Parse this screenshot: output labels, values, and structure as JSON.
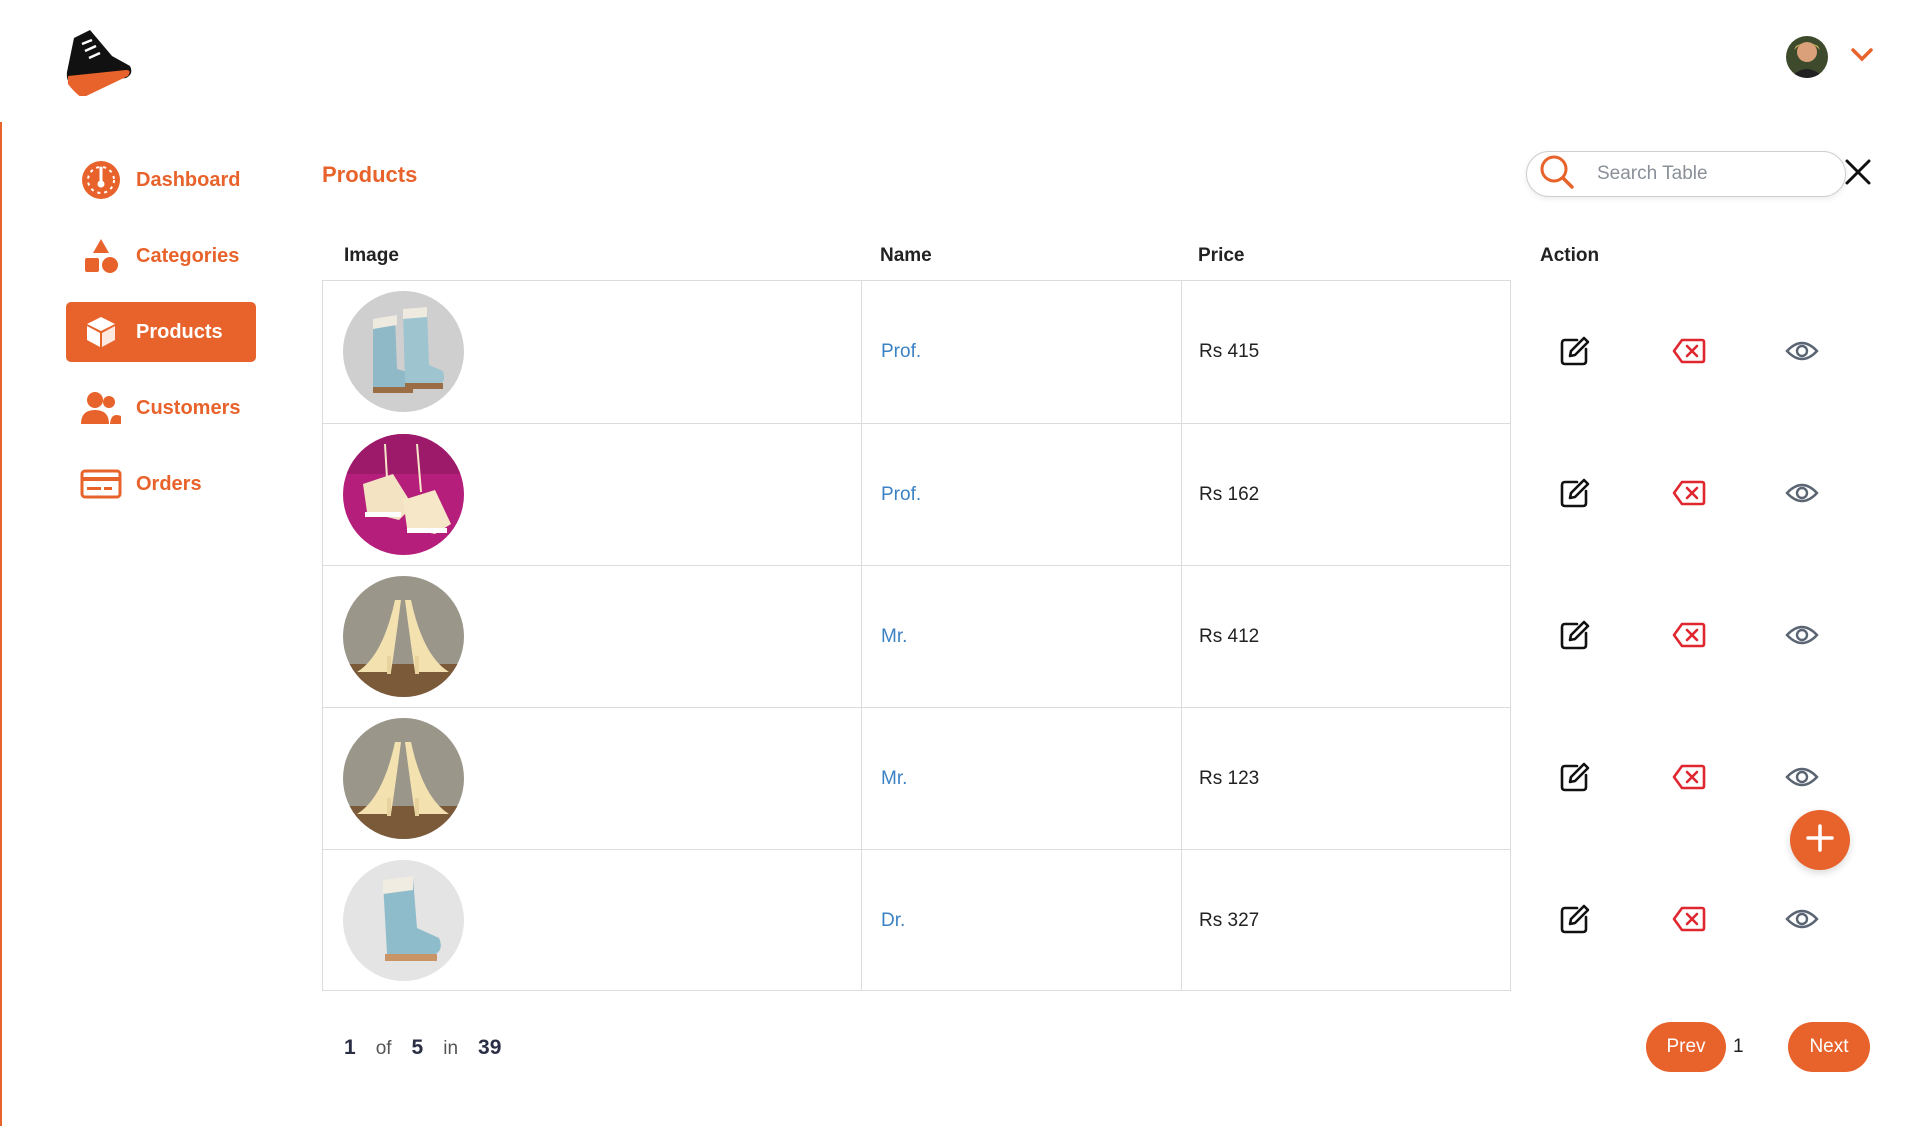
{
  "brand": {
    "logo_icon": "sneaker-logo-icon"
  },
  "colors": {
    "accent": "#e8632b",
    "link": "#3b82c4",
    "danger": "#e0262f",
    "eye": "#5a6472"
  },
  "user": {
    "avatar_icon": "user-avatar",
    "menu_icon": "chevron-down-icon"
  },
  "sidebar": {
    "items": [
      {
        "label": "Dashboard",
        "icon": "speedometer-icon",
        "active": false
      },
      {
        "label": "Categories",
        "icon": "shapes-icon",
        "active": false
      },
      {
        "label": "Products",
        "icon": "box-icon",
        "active": true
      },
      {
        "label": "Customers",
        "icon": "users-icon",
        "active": false
      },
      {
        "label": "Orders",
        "icon": "credit-card-icon",
        "active": false
      }
    ]
  },
  "page": {
    "title": "Products"
  },
  "search": {
    "placeholder": "Search Table",
    "value": ""
  },
  "table": {
    "headers": {
      "image": "Image",
      "name": "Name",
      "price": "Price",
      "action": "Action"
    },
    "rows": [
      {
        "image": "light-blue-boots",
        "name": "Prof.",
        "price": "Rs 415"
      },
      {
        "image": "cream-sneakers-pink-background",
        "name": "Prof.",
        "price": "Rs 162"
      },
      {
        "image": "cream-high-heels",
        "name": "Mr.",
        "price": "Rs 412"
      },
      {
        "image": "cream-high-heels",
        "name": "Mr.",
        "price": "Rs 123"
      },
      {
        "image": "light-blue-boot",
        "name": "Dr.",
        "price": "Rs 327"
      }
    ],
    "actions": [
      "edit-icon",
      "delete-icon",
      "view-icon"
    ]
  },
  "add_button": {
    "icon": "plus-icon"
  },
  "pagination": {
    "current": "1",
    "of_label": "of",
    "total_pages": "5",
    "in_label": "in",
    "total_items": "39",
    "prev_label": "Prev",
    "next_label": "Next",
    "page_number": "1"
  }
}
